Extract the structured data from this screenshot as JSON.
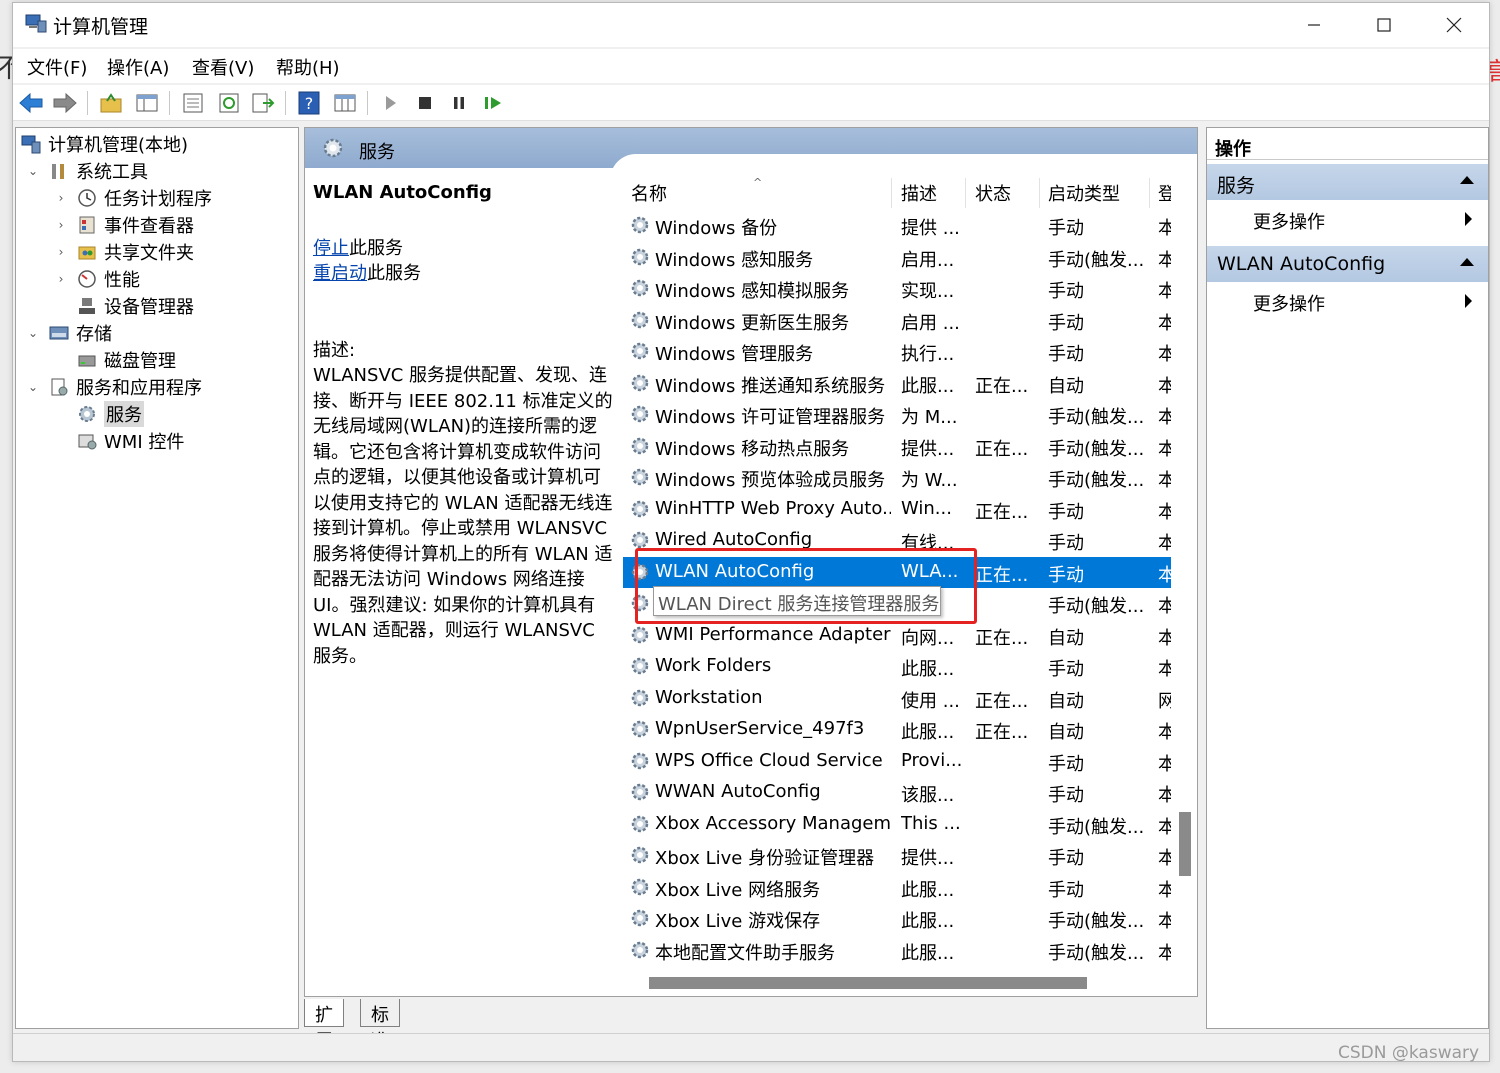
{
  "window": {
    "title": "计算机管理"
  },
  "menu": [
    "文件(F)",
    "操作(A)",
    "查看(V)",
    "帮助(H)"
  ],
  "tree": [
    {
      "label": "计算机管理(本地)",
      "icon": "computer-management-icon",
      "chev": ""
    },
    {
      "label": "系统工具",
      "icon": "tools-icon",
      "chev": "⌄"
    },
    {
      "label": "任务计划程序",
      "icon": "clock-icon",
      "chev": "›"
    },
    {
      "label": "事件查看器",
      "icon": "event-viewer-icon",
      "chev": "›"
    },
    {
      "label": "共享文件夹",
      "icon": "shared-folder-icon",
      "chev": "›"
    },
    {
      "label": "性能",
      "icon": "performance-icon",
      "chev": "›"
    },
    {
      "label": "设备管理器",
      "icon": "device-manager-icon",
      "chev": ""
    },
    {
      "label": "存储",
      "icon": "storage-icon",
      "chev": "⌄"
    },
    {
      "label": "磁盘管理",
      "icon": "disk-icon",
      "chev": ""
    },
    {
      "label": "服务和应用程序",
      "icon": "services-apps-icon",
      "chev": "⌄"
    },
    {
      "label": "服务",
      "icon": "gear-icon",
      "chev": ""
    },
    {
      "label": "WMI 控件",
      "icon": "wmi-icon",
      "chev": ""
    }
  ],
  "center": {
    "header": "服务",
    "selected_service": "WLAN AutoConfig",
    "stop_link": "停止",
    "stop_suffix": "此服务",
    "restart_link": "重启动",
    "restart_suffix": "此服务",
    "desc_label": "描述:",
    "desc_text": "WLANSVC 服务提供配置、发现、连接、断开与 IEEE 802.11 标准定义的无线局域网(WLAN)的连接所需的逻辑。它还包含将计算机变成软件访问点的逻辑，以便其他设备或计算机可以使用支持它的 WLAN 适配器无线连接到计算机。停止或禁用 WLANSVC 服务将使得计算机上的所有 WLAN 适配器无法访问 Windows 网络连接 UI。强烈建议: 如果你的计算机具有 WLAN 适配器，则运行 WLANSVC 服务。"
  },
  "columns": {
    "name": "名称",
    "desc": "描述",
    "status": "状态",
    "startup": "启动类型",
    "logon": "登"
  },
  "services": [
    {
      "name": "Windows 备份",
      "desc": "提供 ...",
      "status": "",
      "startup": "手动",
      "logon": "本"
    },
    {
      "name": "Windows 感知服务",
      "desc": "启用...",
      "status": "",
      "startup": "手动(触发...",
      "logon": "本"
    },
    {
      "name": "Windows 感知模拟服务",
      "desc": "实现...",
      "status": "",
      "startup": "手动",
      "logon": "本"
    },
    {
      "name": "Windows 更新医生服务",
      "desc": "启用 ...",
      "status": "",
      "startup": "手动",
      "logon": "本"
    },
    {
      "name": "Windows 管理服务",
      "desc": "执行...",
      "status": "",
      "startup": "手动",
      "logon": "本"
    },
    {
      "name": "Windows 推送通知系统服务",
      "desc": "此服...",
      "status": "正在...",
      "startup": "自动",
      "logon": "本"
    },
    {
      "name": "Windows 许可证管理器服务",
      "desc": "为 M...",
      "status": "",
      "startup": "手动(触发...",
      "logon": "本"
    },
    {
      "name": "Windows 移动热点服务",
      "desc": "提供...",
      "status": "正在...",
      "startup": "手动(触发...",
      "logon": "本"
    },
    {
      "name": "Windows 预览体验成员服务",
      "desc": "为 W...",
      "status": "",
      "startup": "手动(触发...",
      "logon": "本"
    },
    {
      "name": "WinHTTP Web Proxy Auto...",
      "desc": "Win...",
      "status": "正在...",
      "startup": "手动",
      "logon": "本"
    },
    {
      "name": "Wired AutoConfig",
      "desc": "有线...",
      "status": "",
      "startup": "手动",
      "logon": "本"
    },
    {
      "name": "WLAN AutoConfig",
      "desc": "WLA...",
      "status": "正在...",
      "startup": "手动",
      "logon": "本"
    },
    {
      "name": "WLAN Direct 服务连接管理器服务",
      "desc": "...",
      "status": "",
      "startup": "手动(触发...",
      "logon": "本"
    },
    {
      "name": "WMI Performance Adapter",
      "desc": "向网...",
      "status": "正在...",
      "startup": "自动",
      "logon": "本"
    },
    {
      "name": "Work Folders",
      "desc": "此服...",
      "status": "",
      "startup": "手动",
      "logon": "本"
    },
    {
      "name": "Workstation",
      "desc": "使用 ...",
      "status": "正在...",
      "startup": "自动",
      "logon": "网"
    },
    {
      "name": "WpnUserService_497f3",
      "desc": "此服...",
      "status": "正在...",
      "startup": "自动",
      "logon": "本"
    },
    {
      "name": "WPS Office Cloud Service",
      "desc": "Provi...",
      "status": "",
      "startup": "手动",
      "logon": "本"
    },
    {
      "name": "WWAN AutoConfig",
      "desc": "该服...",
      "status": "",
      "startup": "手动",
      "logon": "本"
    },
    {
      "name": "Xbox Accessory Managem...",
      "desc": "This ...",
      "status": "",
      "startup": "手动(触发...",
      "logon": "本"
    },
    {
      "name": "Xbox Live 身份验证管理器",
      "desc": "提供...",
      "status": "",
      "startup": "手动",
      "logon": "本"
    },
    {
      "name": "Xbox Live 网络服务",
      "desc": "此服...",
      "status": "",
      "startup": "手动",
      "logon": "本"
    },
    {
      "name": "Xbox Live 游戏保存",
      "desc": "此服...",
      "status": "",
      "startup": "手动(触发...",
      "logon": "本"
    },
    {
      "name": "本地配置文件助手服务",
      "desc": "此服...",
      "status": "",
      "startup": "手动(触发...",
      "logon": "本"
    }
  ],
  "selected_index": 11,
  "tooltip": "WLAN Direct 服务连接管理器服务",
  "tabs": [
    "扩展",
    "标准"
  ],
  "actions": {
    "title": "操作",
    "groups": [
      {
        "label": "服务",
        "item": "更多操作"
      },
      {
        "label": "WLAN AutoConfig",
        "item": "更多操作"
      }
    ]
  },
  "watermark": "CSDN @kaswary",
  "colors": {
    "selection": "#0078d7",
    "highlight_box": "#e52222",
    "header_gradient": "#a7bedb",
    "link": "#0645ad"
  }
}
